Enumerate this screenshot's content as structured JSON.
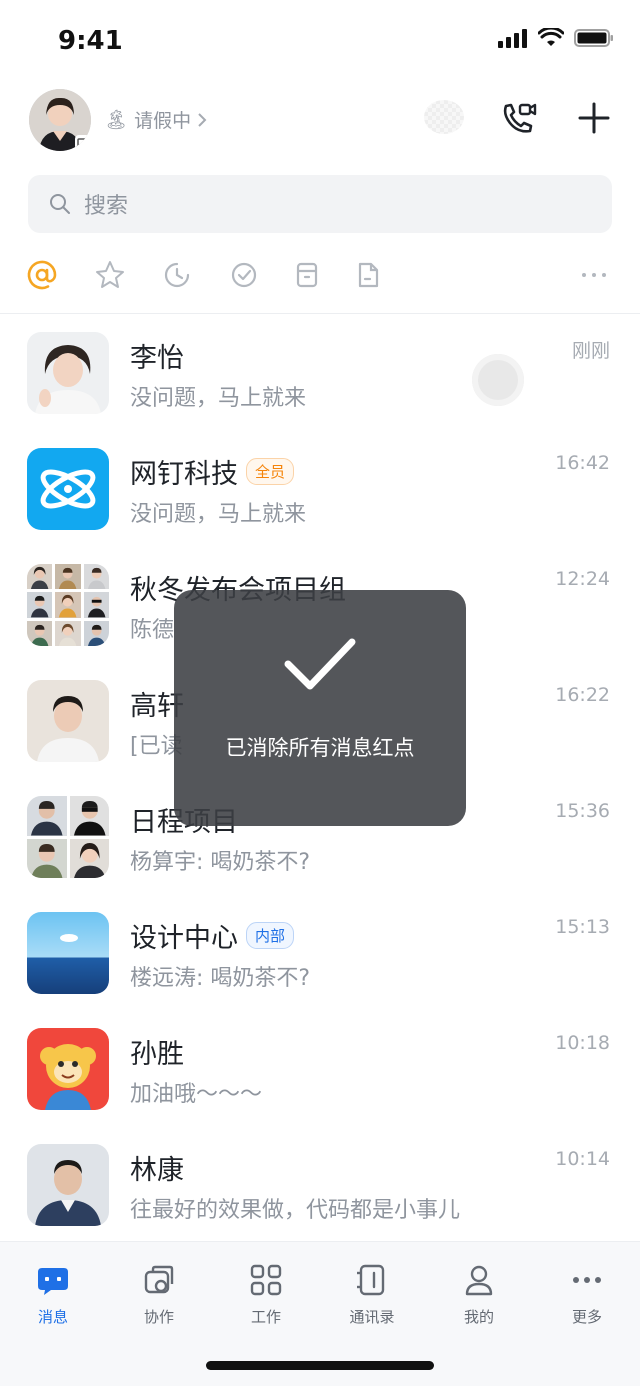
{
  "status_bar": {
    "time": "9:41"
  },
  "header": {
    "status_text": "请假中",
    "status_emoji": "🏝"
  },
  "search": {
    "placeholder": "搜索"
  },
  "filters": [
    "at-icon",
    "star-icon",
    "clock-icon",
    "check-circle-icon",
    "archive-icon",
    "doc-icon",
    "more-dots-icon"
  ],
  "chats": [
    {
      "name": "李怡",
      "message": "没问题，马上就来",
      "time": "刚刚",
      "tag": ""
    },
    {
      "name": "网钉科技",
      "message": "没问题，马上就来",
      "time": "16:42",
      "tag": "全员"
    },
    {
      "name": "秋冬发布会项目组",
      "message": "陈德",
      "time": "12:24",
      "tag": ""
    },
    {
      "name": "高轩",
      "message": "[已读",
      "time": "16:22",
      "tag": ""
    },
    {
      "name": "日程项目",
      "message": "杨算宇: 喝奶茶不?",
      "time": "15:36",
      "tag": ""
    },
    {
      "name": "设计中心",
      "message": "楼远涛: 喝奶茶不?",
      "time": "15:13",
      "tag": "内部"
    },
    {
      "name": "孙胜",
      "message": "加油哦～～～",
      "time": "10:18",
      "tag": ""
    },
    {
      "name": "林康",
      "message": "往最好的效果做，代码都是小事儿",
      "time": "10:14",
      "tag": ""
    }
  ],
  "toast": {
    "text": "已消除所有消息红点"
  },
  "tabs": [
    {
      "label": "消息",
      "icon": "message-icon",
      "active": true
    },
    {
      "label": "协作",
      "icon": "collab-icon",
      "active": false
    },
    {
      "label": "工作",
      "icon": "grid-icon",
      "active": false
    },
    {
      "label": "通讯录",
      "icon": "contacts-icon",
      "active": false
    },
    {
      "label": "我的",
      "icon": "profile-icon",
      "active": false
    },
    {
      "label": "更多",
      "icon": "more-icon",
      "active": false
    }
  ],
  "colors": {
    "accent": "#1f70e6",
    "orange": "#f5a623",
    "toast_bg": "#3c3f43"
  }
}
